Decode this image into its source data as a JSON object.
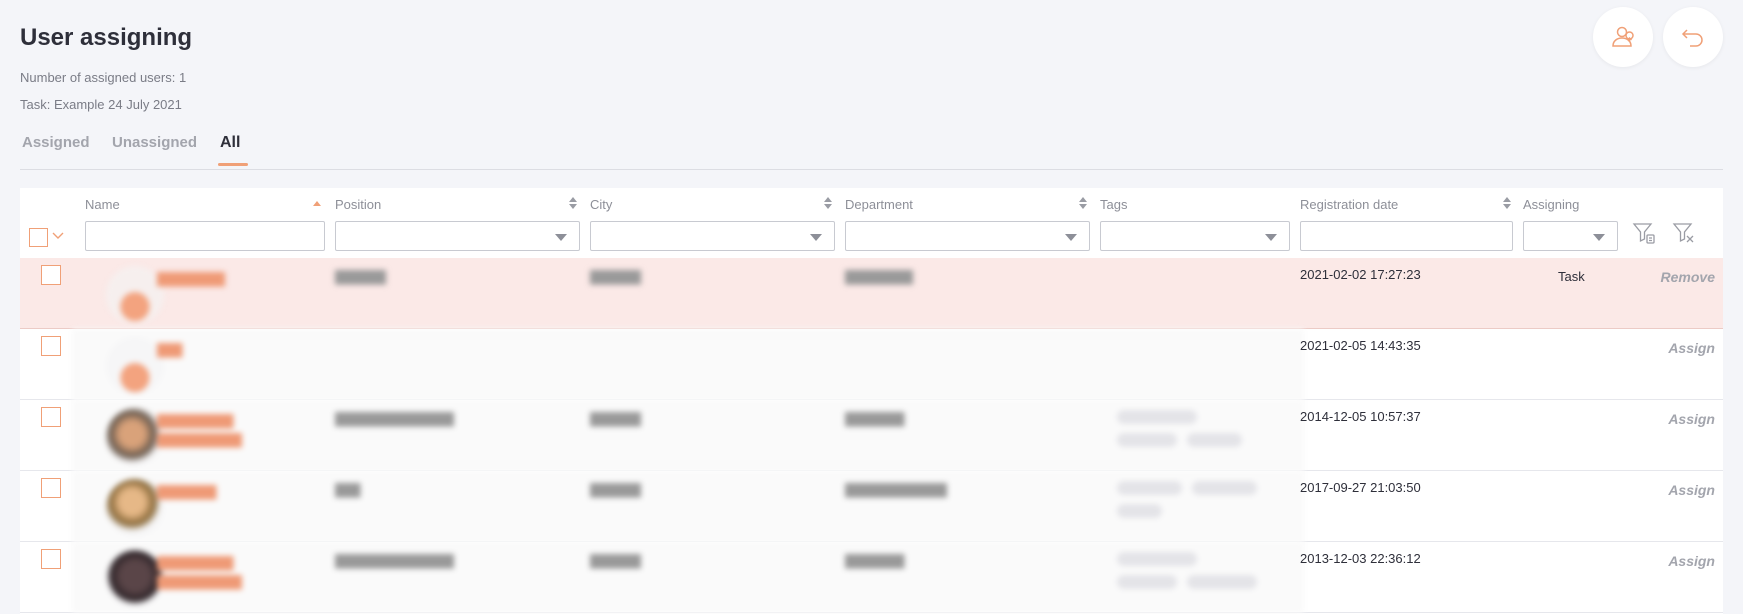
{
  "header": {
    "title": "User assigning",
    "assigned_count_text": "Number of assigned users: 1",
    "task_text": "Task: Example 24 July 2021"
  },
  "actions": {
    "assign_users_icon": "users-add-icon",
    "back_icon": "undo-arrow-icon"
  },
  "tabs": [
    {
      "label": "Assigned",
      "active": false
    },
    {
      "label": "Unassigned",
      "active": false
    },
    {
      "label": "All",
      "active": true
    }
  ],
  "table": {
    "columns": [
      {
        "label": "Name",
        "sort": "ascending"
      },
      {
        "label": "Position",
        "sort": "none"
      },
      {
        "label": "City",
        "sort": "none"
      },
      {
        "label": "Department",
        "sort": "none"
      },
      {
        "label": "Tags",
        "sort": null
      },
      {
        "label": "Registration date",
        "sort": "none"
      },
      {
        "label": "Assigning",
        "sort": null
      }
    ],
    "rows": [
      {
        "registration_date": "2021-02-02 17:27:23",
        "assigning": "Task",
        "action": "Remove",
        "highlighted": true
      },
      {
        "registration_date": "2021-02-05 14:43:35",
        "assigning": "",
        "action": "Assign",
        "highlighted": false
      },
      {
        "registration_date": "2014-12-05 10:57:37",
        "assigning": "",
        "action": "Assign",
        "highlighted": false
      },
      {
        "registration_date": "2017-09-27 21:03:50",
        "assigning": "",
        "action": "Assign",
        "highlighted": false
      },
      {
        "registration_date": "2013-12-03 22:36:12",
        "assigning": "",
        "action": "Assign",
        "highlighted": false
      }
    ]
  },
  "colors": {
    "accent": "#f0a077",
    "highlight_row": "#fbe9e7",
    "background": "#f4f5f9",
    "muted_text": "#a3a5ad"
  }
}
